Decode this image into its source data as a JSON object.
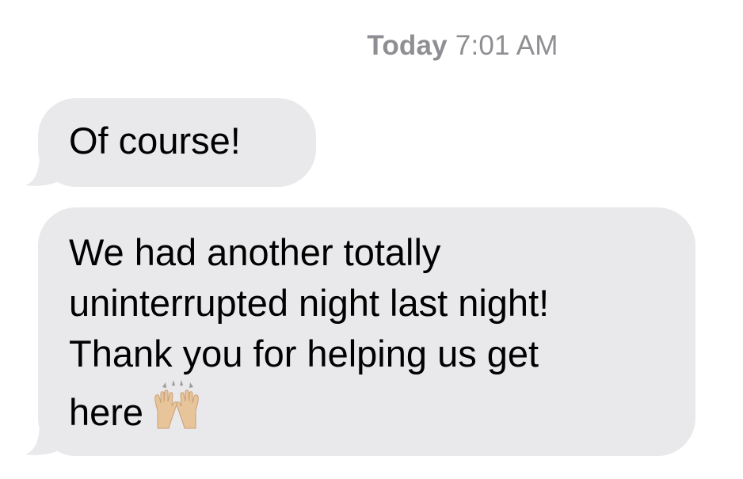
{
  "conversation": {
    "timestamp": {
      "day": "Today",
      "time": "7:01 AM"
    },
    "messages": [
      {
        "direction": "incoming",
        "lines": [
          "Of course!"
        ]
      },
      {
        "direction": "incoming",
        "lines": [
          "We had another totally",
          "uninterrupted night last night!",
          "Thank you for helping us get",
          "here"
        ],
        "emoji": "raising-hands-emoji"
      }
    ]
  },
  "colors": {
    "bubble_incoming": "#e9e9eb",
    "timestamp_text": "#8e8e93",
    "message_text": "#000000"
  }
}
